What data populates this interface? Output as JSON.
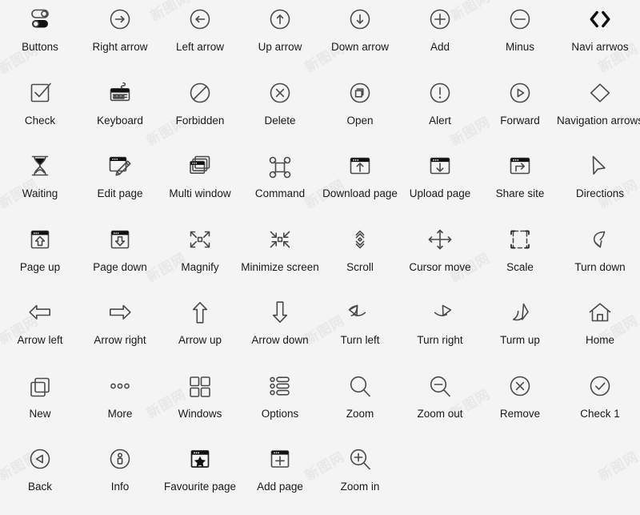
{
  "page": {
    "background_color": "#f4f4f4",
    "label_color": "#1a1a1a",
    "stroke_color": "#4a4a4a",
    "watermark_text": "新图网",
    "columns": 8,
    "rows": 7
  },
  "icons": [
    {
      "label": "Buttons",
      "icon": "toggle-switches-icon"
    },
    {
      "label": "Right arrow",
      "icon": "circle-arrow-right-icon"
    },
    {
      "label": "Left arrow",
      "icon": "circle-arrow-left-icon"
    },
    {
      "label": "Up arrow",
      "icon": "circle-arrow-up-icon"
    },
    {
      "label": "Down arrow",
      "icon": "circle-arrow-down-icon"
    },
    {
      "label": "Add",
      "icon": "circle-plus-icon"
    },
    {
      "label": "Minus",
      "icon": "circle-minus-icon"
    },
    {
      "label": "Navi arrwos",
      "icon": "chevron-left-right-bold-icon"
    },
    {
      "label": "Check",
      "icon": "checkbox-check-icon"
    },
    {
      "label": "Keyboard",
      "icon": "keyboard-icon"
    },
    {
      "label": "Forbidden",
      "icon": "circle-slash-icon"
    },
    {
      "label": "Delete",
      "icon": "circle-x-icon"
    },
    {
      "label": "Open",
      "icon": "circle-copy-icon"
    },
    {
      "label": "Alert",
      "icon": "circle-exclamation-icon"
    },
    {
      "label": "Forward",
      "icon": "circle-play-icon"
    },
    {
      "label": "Navigation arrows",
      "icon": "diamond-outline-icon"
    },
    {
      "label": "Waiting",
      "icon": "hourglass-icon"
    },
    {
      "label": "Edit page",
      "icon": "browser-pencil-icon"
    },
    {
      "label": "Multi window",
      "icon": "multi-window-icon"
    },
    {
      "label": "Command",
      "icon": "command-key-icon"
    },
    {
      "label": "Download page",
      "icon": "browser-arrow-up-icon"
    },
    {
      "label": "Upload page",
      "icon": "browser-arrow-down-icon"
    },
    {
      "label": "Share site",
      "icon": "browser-share-arrow-icon"
    },
    {
      "label": "Directions",
      "icon": "cursor-pointer-icon"
    },
    {
      "label": "Page up",
      "icon": "browser-page-up-icon"
    },
    {
      "label": "Page down",
      "icon": "browser-page-down-icon"
    },
    {
      "label": "Magnify",
      "icon": "expand-four-arrows-icon"
    },
    {
      "label": "Minimize screen",
      "icon": "collapse-four-arrows-icon"
    },
    {
      "label": "Scroll",
      "icon": "scroll-chevrons-icon"
    },
    {
      "label": "Cursor move",
      "icon": "move-cross-arrows-icon"
    },
    {
      "label": "Scale",
      "icon": "scale-frame-icon"
    },
    {
      "label": "Turn down",
      "icon": "turn-down-arrow-icon"
    },
    {
      "label": "Arrow left",
      "icon": "block-arrow-left-icon"
    },
    {
      "label": "Arrow right",
      "icon": "block-arrow-right-icon"
    },
    {
      "label": "Arrow up",
      "icon": "block-arrow-up-icon"
    },
    {
      "label": "Arrow down",
      "icon": "block-arrow-down-icon"
    },
    {
      "label": "Turn left",
      "icon": "turn-left-arrow-icon"
    },
    {
      "label": "Turn right",
      "icon": "turn-right-arrow-icon"
    },
    {
      "label": "Turm up",
      "icon": "turn-up-arrow-icon"
    },
    {
      "label": "Home",
      "icon": "home-icon"
    },
    {
      "label": "New",
      "icon": "copy-squares-icon"
    },
    {
      "label": "More",
      "icon": "three-dots-icon"
    },
    {
      "label": "Windows",
      "icon": "grid-four-squares-icon"
    },
    {
      "label": "Options",
      "icon": "options-list-icon"
    },
    {
      "label": "Zoom",
      "icon": "magnifier-icon"
    },
    {
      "label": "Zoom out",
      "icon": "magnifier-minus-icon"
    },
    {
      "label": "Remove",
      "icon": "circle-x-thin-icon"
    },
    {
      "label": "Check 1",
      "icon": "circle-check-icon"
    },
    {
      "label": "Back",
      "icon": "circle-triangle-left-icon"
    },
    {
      "label": "Info",
      "icon": "circle-info-icon"
    },
    {
      "label": "Favourite page",
      "icon": "browser-star-icon"
    },
    {
      "label": "Add page",
      "icon": "browser-plus-icon"
    },
    {
      "label": "Zoom in",
      "icon": "magnifier-plus-icon"
    }
  ]
}
